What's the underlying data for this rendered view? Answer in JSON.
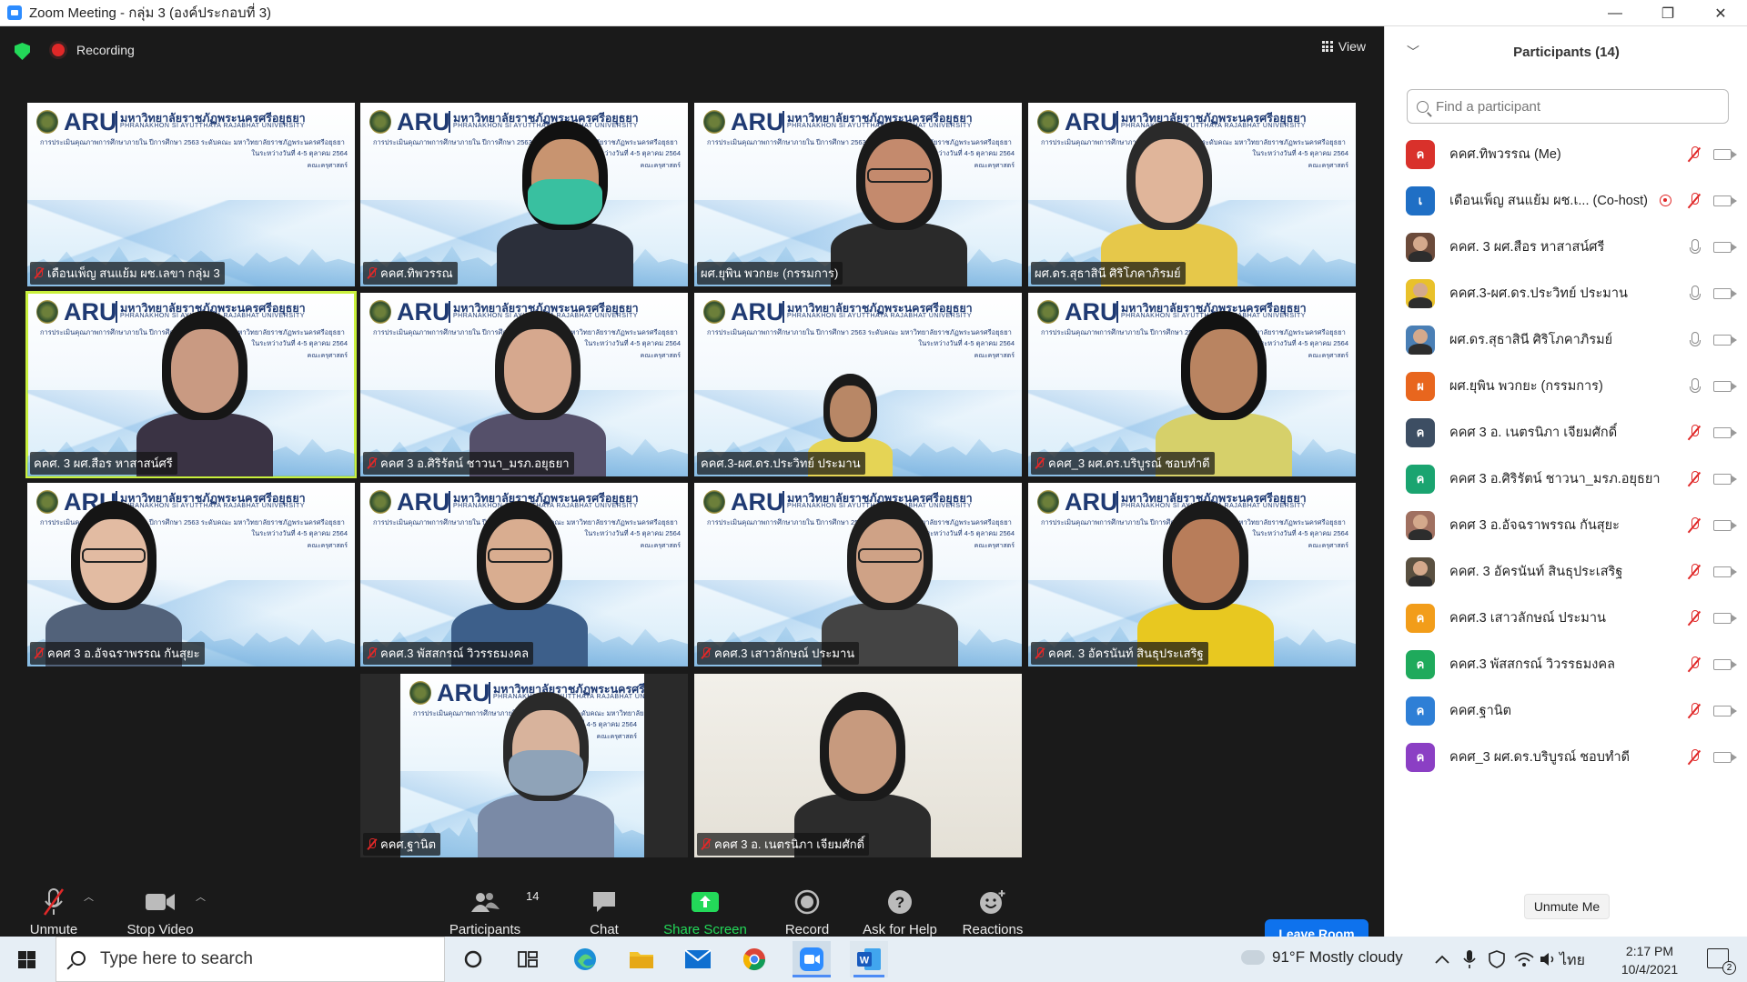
{
  "window": {
    "title": "Zoom Meeting - กลุ่ม 3 (องค์ประกอบที่ 3)",
    "minimize": "—",
    "restore": "❐",
    "close": "✕"
  },
  "topbar": {
    "recording": "Recording",
    "view": "View"
  },
  "banner": {
    "aru": "ARU",
    "university_th": "มหาวิทยาลัยราชภัฏพระนครศรีอยุธยา",
    "university_en": "PHRANAKHON SI AYUTTHAYA RAJABHAT UNIVERSITY",
    "line1": "การประเมินคุณภาพการศึกษาภายใน ปีการศึกษา 2563 ระดับคณะ มหาวิทยาลัยราชภัฏพระนครศรีอยุธยา",
    "line2": "ในระหว่างวันที่ 4-5 ตุลาคม 2564",
    "line3": "คณะครุศาสตร์"
  },
  "tiles": [
    {
      "name": "เดือนเพ็ญ  สนแย้ม ผช.เลขา กลุ่ม 3",
      "muted": true
    },
    {
      "name": "คคศ.ทิพวรรณ",
      "muted": true
    },
    {
      "name": "ผศ.ยุพิน  พวกยะ (กรรมการ)",
      "muted": false
    },
    {
      "name": "ผศ.ดร.สุธาสินี ศิริโภคาภิรมย์",
      "muted": false
    },
    {
      "name": "คคศ. 3 ผศ.สือร หาสาสน์ศรี",
      "muted": false
    },
    {
      "name": "คคศ 3 อ.ศิริรัตน์ ชาวนา_มรภ.อยุธยา",
      "muted": true
    },
    {
      "name": "คคศ.3-ผศ.ดร.ประวิทย์ ประมาน",
      "muted": false
    },
    {
      "name": "คคศ_3 ผศ.ดร.บริบูรณ์ ชอบทำดี",
      "muted": true
    },
    {
      "name": "คคศ 3 อ.อัจฉราพรรณ กันสุยะ",
      "muted": true
    },
    {
      "name": "คคศ.3 พัสสกรณ์ วิวรรธมงคล",
      "muted": true
    },
    {
      "name": "คคศ.3 เสาวลักษณ์ ประมาน",
      "muted": true
    },
    {
      "name": "คคศ. 3 อัครนันท์ สินธุประเสริฐ",
      "muted": true
    },
    {
      "name": "คคศ.ฐานิต",
      "muted": true
    },
    {
      "name": "คคศ 3 อ. เนตรนิภา เจียมศักดิ์",
      "muted": true
    }
  ],
  "toolbar": {
    "unmute": "Unmute",
    "stop_video": "Stop Video",
    "participants": "Participants",
    "participants_count": "14",
    "chat": "Chat",
    "share_screen": "Share Screen",
    "record": "Record",
    "ask_help": "Ask for Help",
    "reactions": "Reactions",
    "leave": "Leave Room"
  },
  "panel": {
    "title": "Participants (14)",
    "search_placeholder": "Find a participant",
    "unmute_me": "Unmute Me",
    "participants": [
      {
        "initial": "ค",
        "name": "คคศ.ทิพวรรณ (Me)",
        "color": "#d9312b",
        "mic": "off",
        "photo": false
      },
      {
        "initial": "เ",
        "name": "เดือนเพ็ญ  สนแย้ม ผช.เ... (Co-host)",
        "color": "#1f6fc5",
        "mic": "off",
        "photo": false,
        "rec": true
      },
      {
        "initial": "",
        "name": "คคศ. 3 ผศ.สือร หาสาสน์ศรี",
        "color": "#6b4a3a",
        "mic": "on",
        "photo": true
      },
      {
        "initial": "",
        "name": "คคศ.3-ผศ.ดร.ประวิทย์ ประมาน",
        "color": "#e9c12a",
        "mic": "on",
        "photo": true
      },
      {
        "initial": "",
        "name": "ผศ.ดร.สุธาสินี ศิริโภคาภิรมย์",
        "color": "#4a7fb5",
        "mic": "on",
        "photo": true
      },
      {
        "initial": "ผ",
        "name": "ผศ.ยุพิน  พวกยะ (กรรมการ)",
        "color": "#e8661e",
        "mic": "on",
        "photo": false
      },
      {
        "initial": "ค",
        "name": "คคศ 3 อ. เนตรนิภา เจียมศักดิ์",
        "color": "#3d4e63",
        "mic": "off",
        "photo": false
      },
      {
        "initial": "ค",
        "name": "คคศ 3 อ.ศิริรัตน์ ชาวนา_มรภ.อยุธยา",
        "color": "#1aa470",
        "mic": "off",
        "photo": false
      },
      {
        "initial": "",
        "name": "คคศ 3 อ.อัจฉราพรรณ กันสุยะ",
        "color": "#a07060",
        "mic": "off",
        "photo": true
      },
      {
        "initial": "",
        "name": "คคศ. 3 อัครนันท์ สินธุประเสริฐ",
        "color": "#5a5040",
        "mic": "off",
        "photo": true
      },
      {
        "initial": "ค",
        "name": "คคศ.3 เสาวลักษณ์ ประมาน",
        "color": "#f29d1a",
        "mic": "off",
        "photo": false
      },
      {
        "initial": "ค",
        "name": "คคศ.3 พัสสกรณ์ วิวรรธมงคล",
        "color": "#1faa5c",
        "mic": "off",
        "photo": false
      },
      {
        "initial": "ค",
        "name": "คคศ.ฐานิต",
        "color": "#2e7fd6",
        "mic": "off",
        "photo": false
      },
      {
        "initial": "ค",
        "name": "คคศ_3 ผศ.ดร.บริบูรณ์ ชอบทำดี",
        "color": "#8b3fc4",
        "mic": "off",
        "photo": false
      }
    ]
  },
  "taskbar": {
    "search_placeholder": "Type here to search",
    "weather": "91°F  Mostly cloudy",
    "lang": "ไทย",
    "time": "2:17 PM",
    "date": "10/4/2021",
    "notifications": "2"
  }
}
